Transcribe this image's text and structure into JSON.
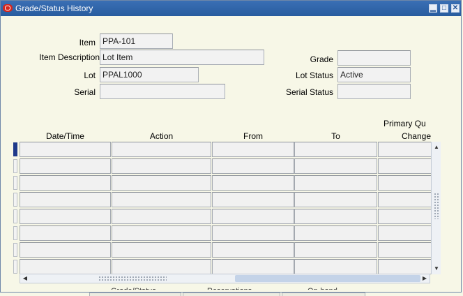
{
  "window": {
    "title": "Grade/Status History"
  },
  "header": {
    "item_label": "Item",
    "item_value": "PPA-101",
    "item_desc_label": "Item Description",
    "item_desc_value": "Lot Item",
    "lot_label": "Lot",
    "lot_value": "PPAL1000",
    "serial_label": "Serial",
    "serial_value": "",
    "grade_label": "Grade",
    "grade_value": "",
    "lot_status_label": "Lot Status",
    "lot_status_value": "Active",
    "serial_status_label": "Serial Status",
    "serial_status_value": ""
  },
  "table": {
    "columns": [
      "Date/Time",
      "Action",
      "From",
      "To",
      "Primary Qu",
      "Change"
    ]
  },
  "footer_tabs": [
    "Grade/Status",
    "Reservations",
    "On-hand"
  ]
}
